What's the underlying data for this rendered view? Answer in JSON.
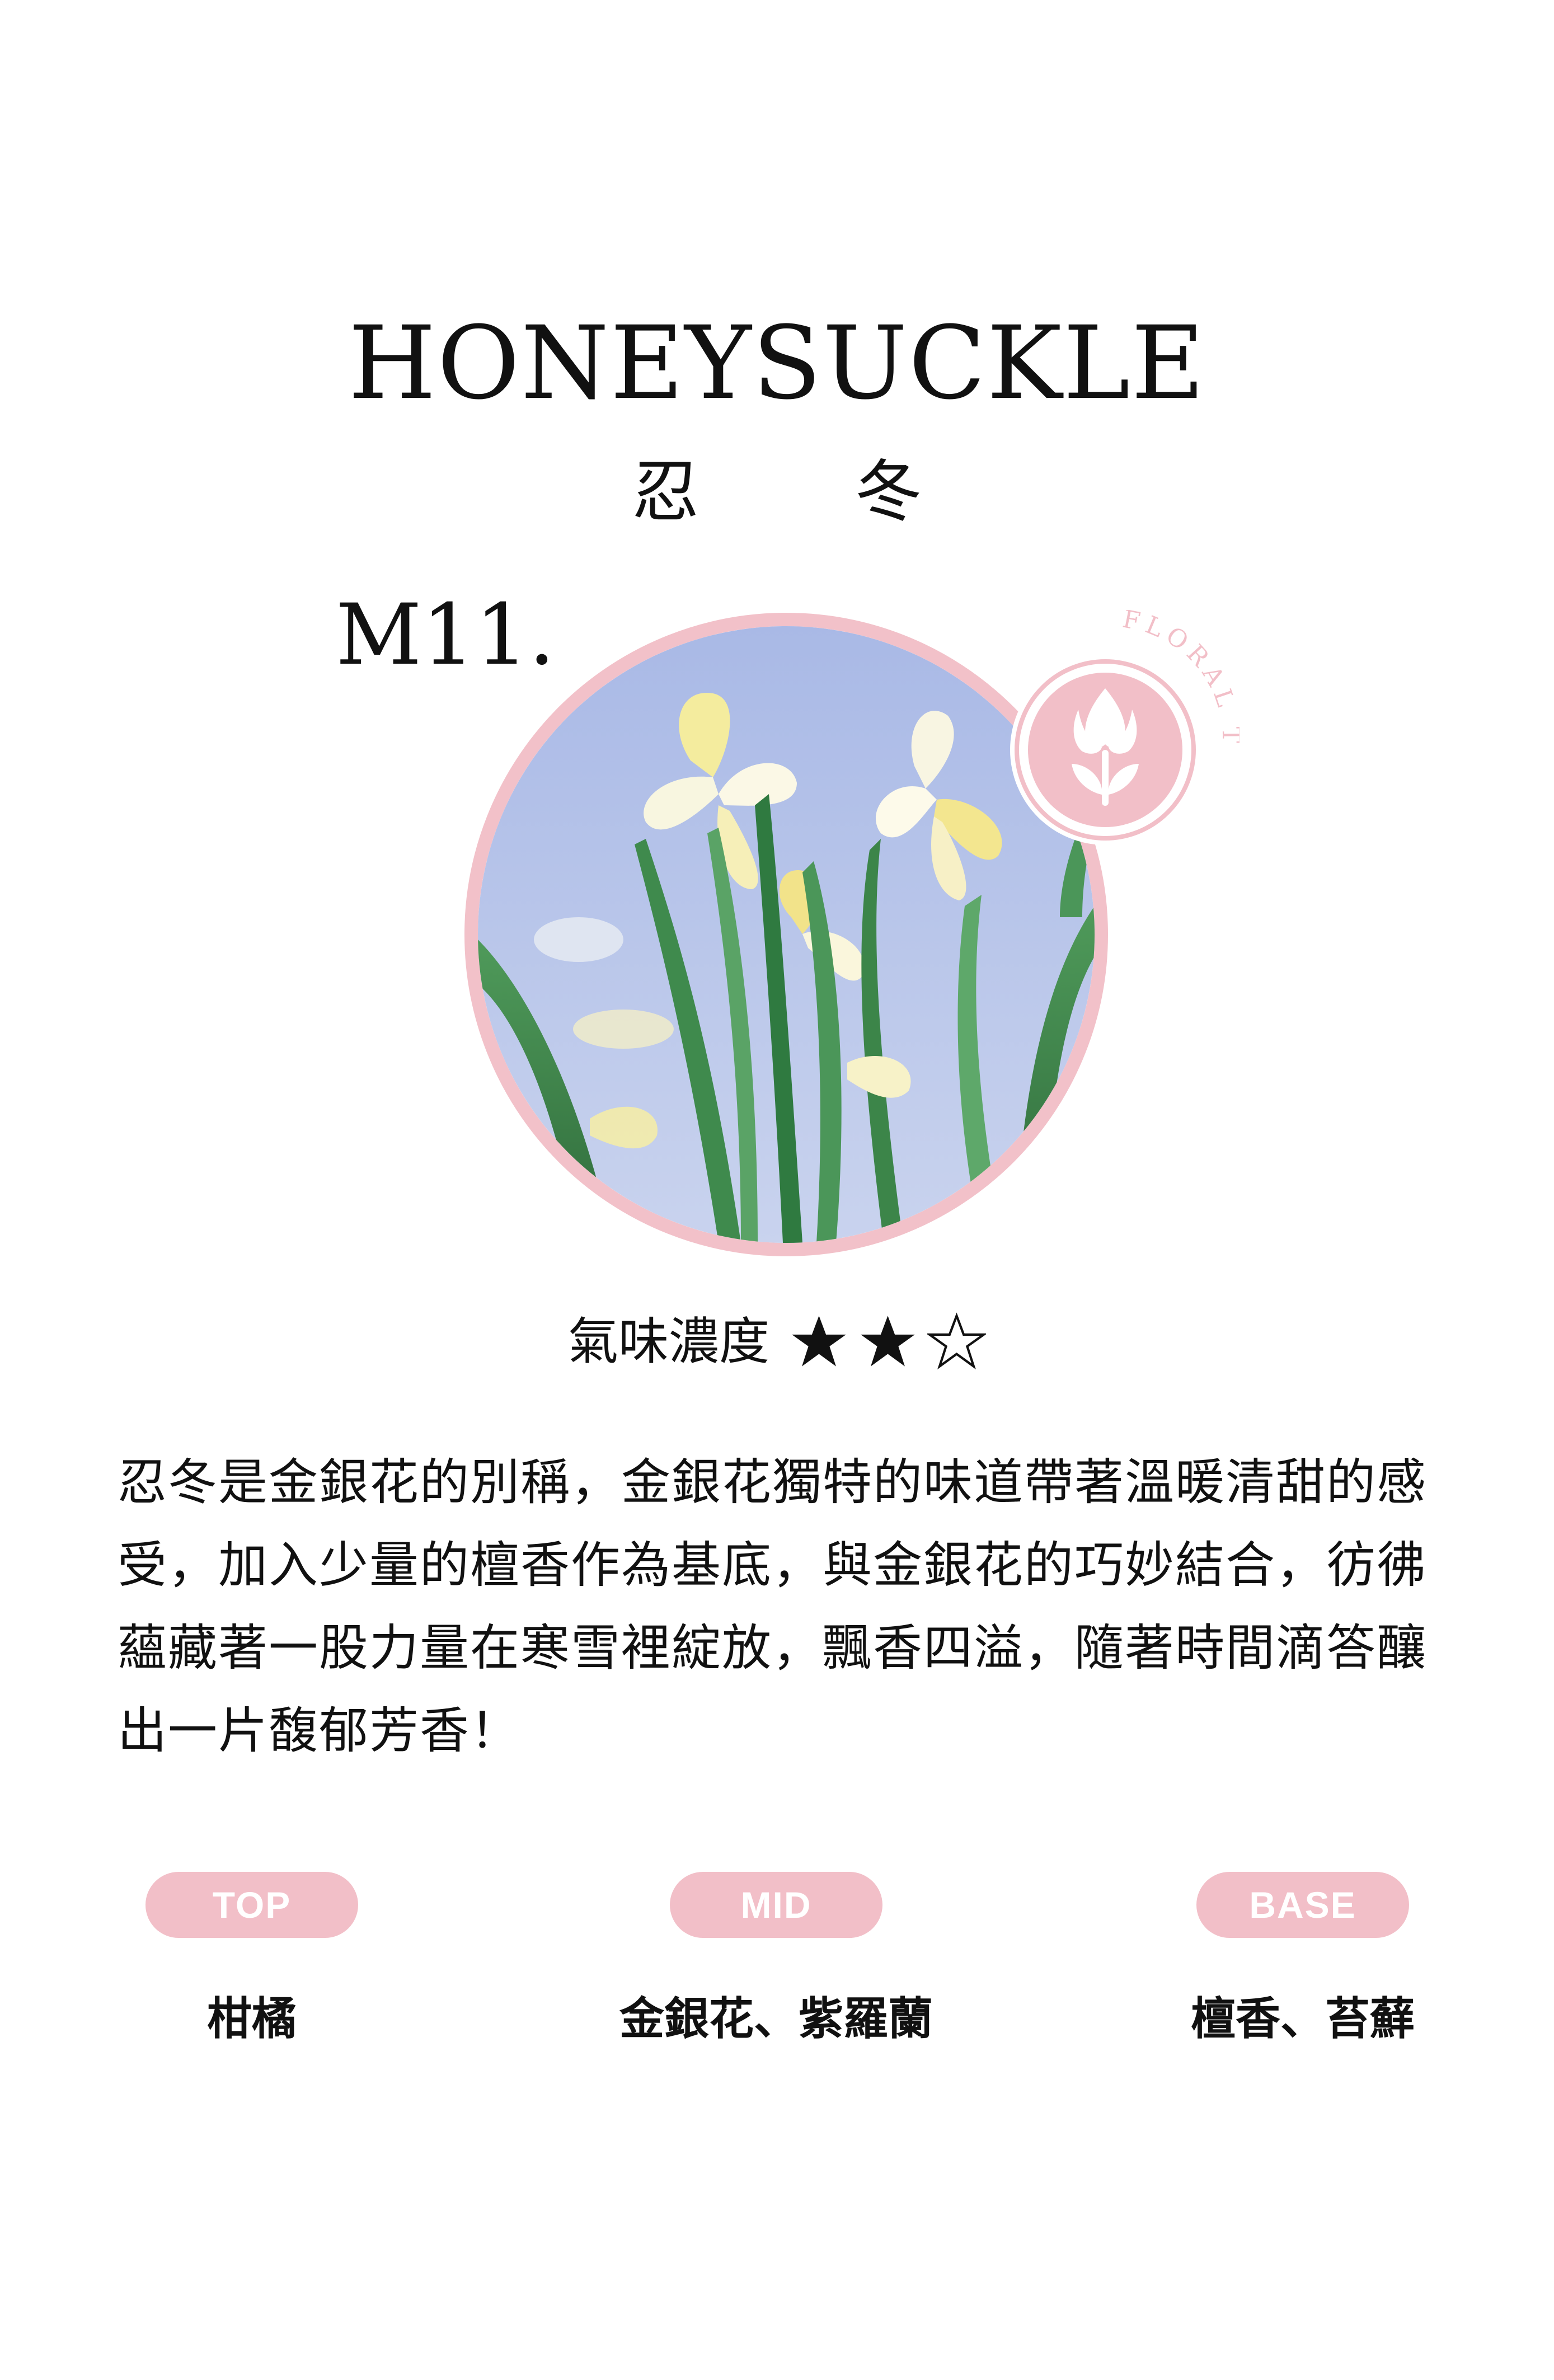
{
  "header": {
    "title": "HONEYSUCKLE",
    "subtitle": "忍 冬",
    "code": "M11."
  },
  "badge": {
    "text": "FLORAL TYPE",
    "icon": "tulip-icon",
    "color": "#f2bfc8"
  },
  "strength": {
    "label": "氣味濃度",
    "rating": 2,
    "max": 3
  },
  "description": "忍冬是金銀花的別稱，金銀花獨特的味道帶著溫暖清甜的感受，加入少量的檀香作為基底，與金銀花的巧妙結合，彷彿蘊藏著一股力量在寒雪裡綻放，飄香四溢，隨著時間滴答釀出一片馥郁芳香！",
  "notes": [
    {
      "label": "TOP",
      "value": "柑橘"
    },
    {
      "label": "MID",
      "value": "金銀花、紫羅蘭"
    },
    {
      "label": "BASE",
      "value": "檀香、苔蘚"
    }
  ],
  "colors": {
    "accent": "#f2bfc8",
    "text": "#111111"
  }
}
